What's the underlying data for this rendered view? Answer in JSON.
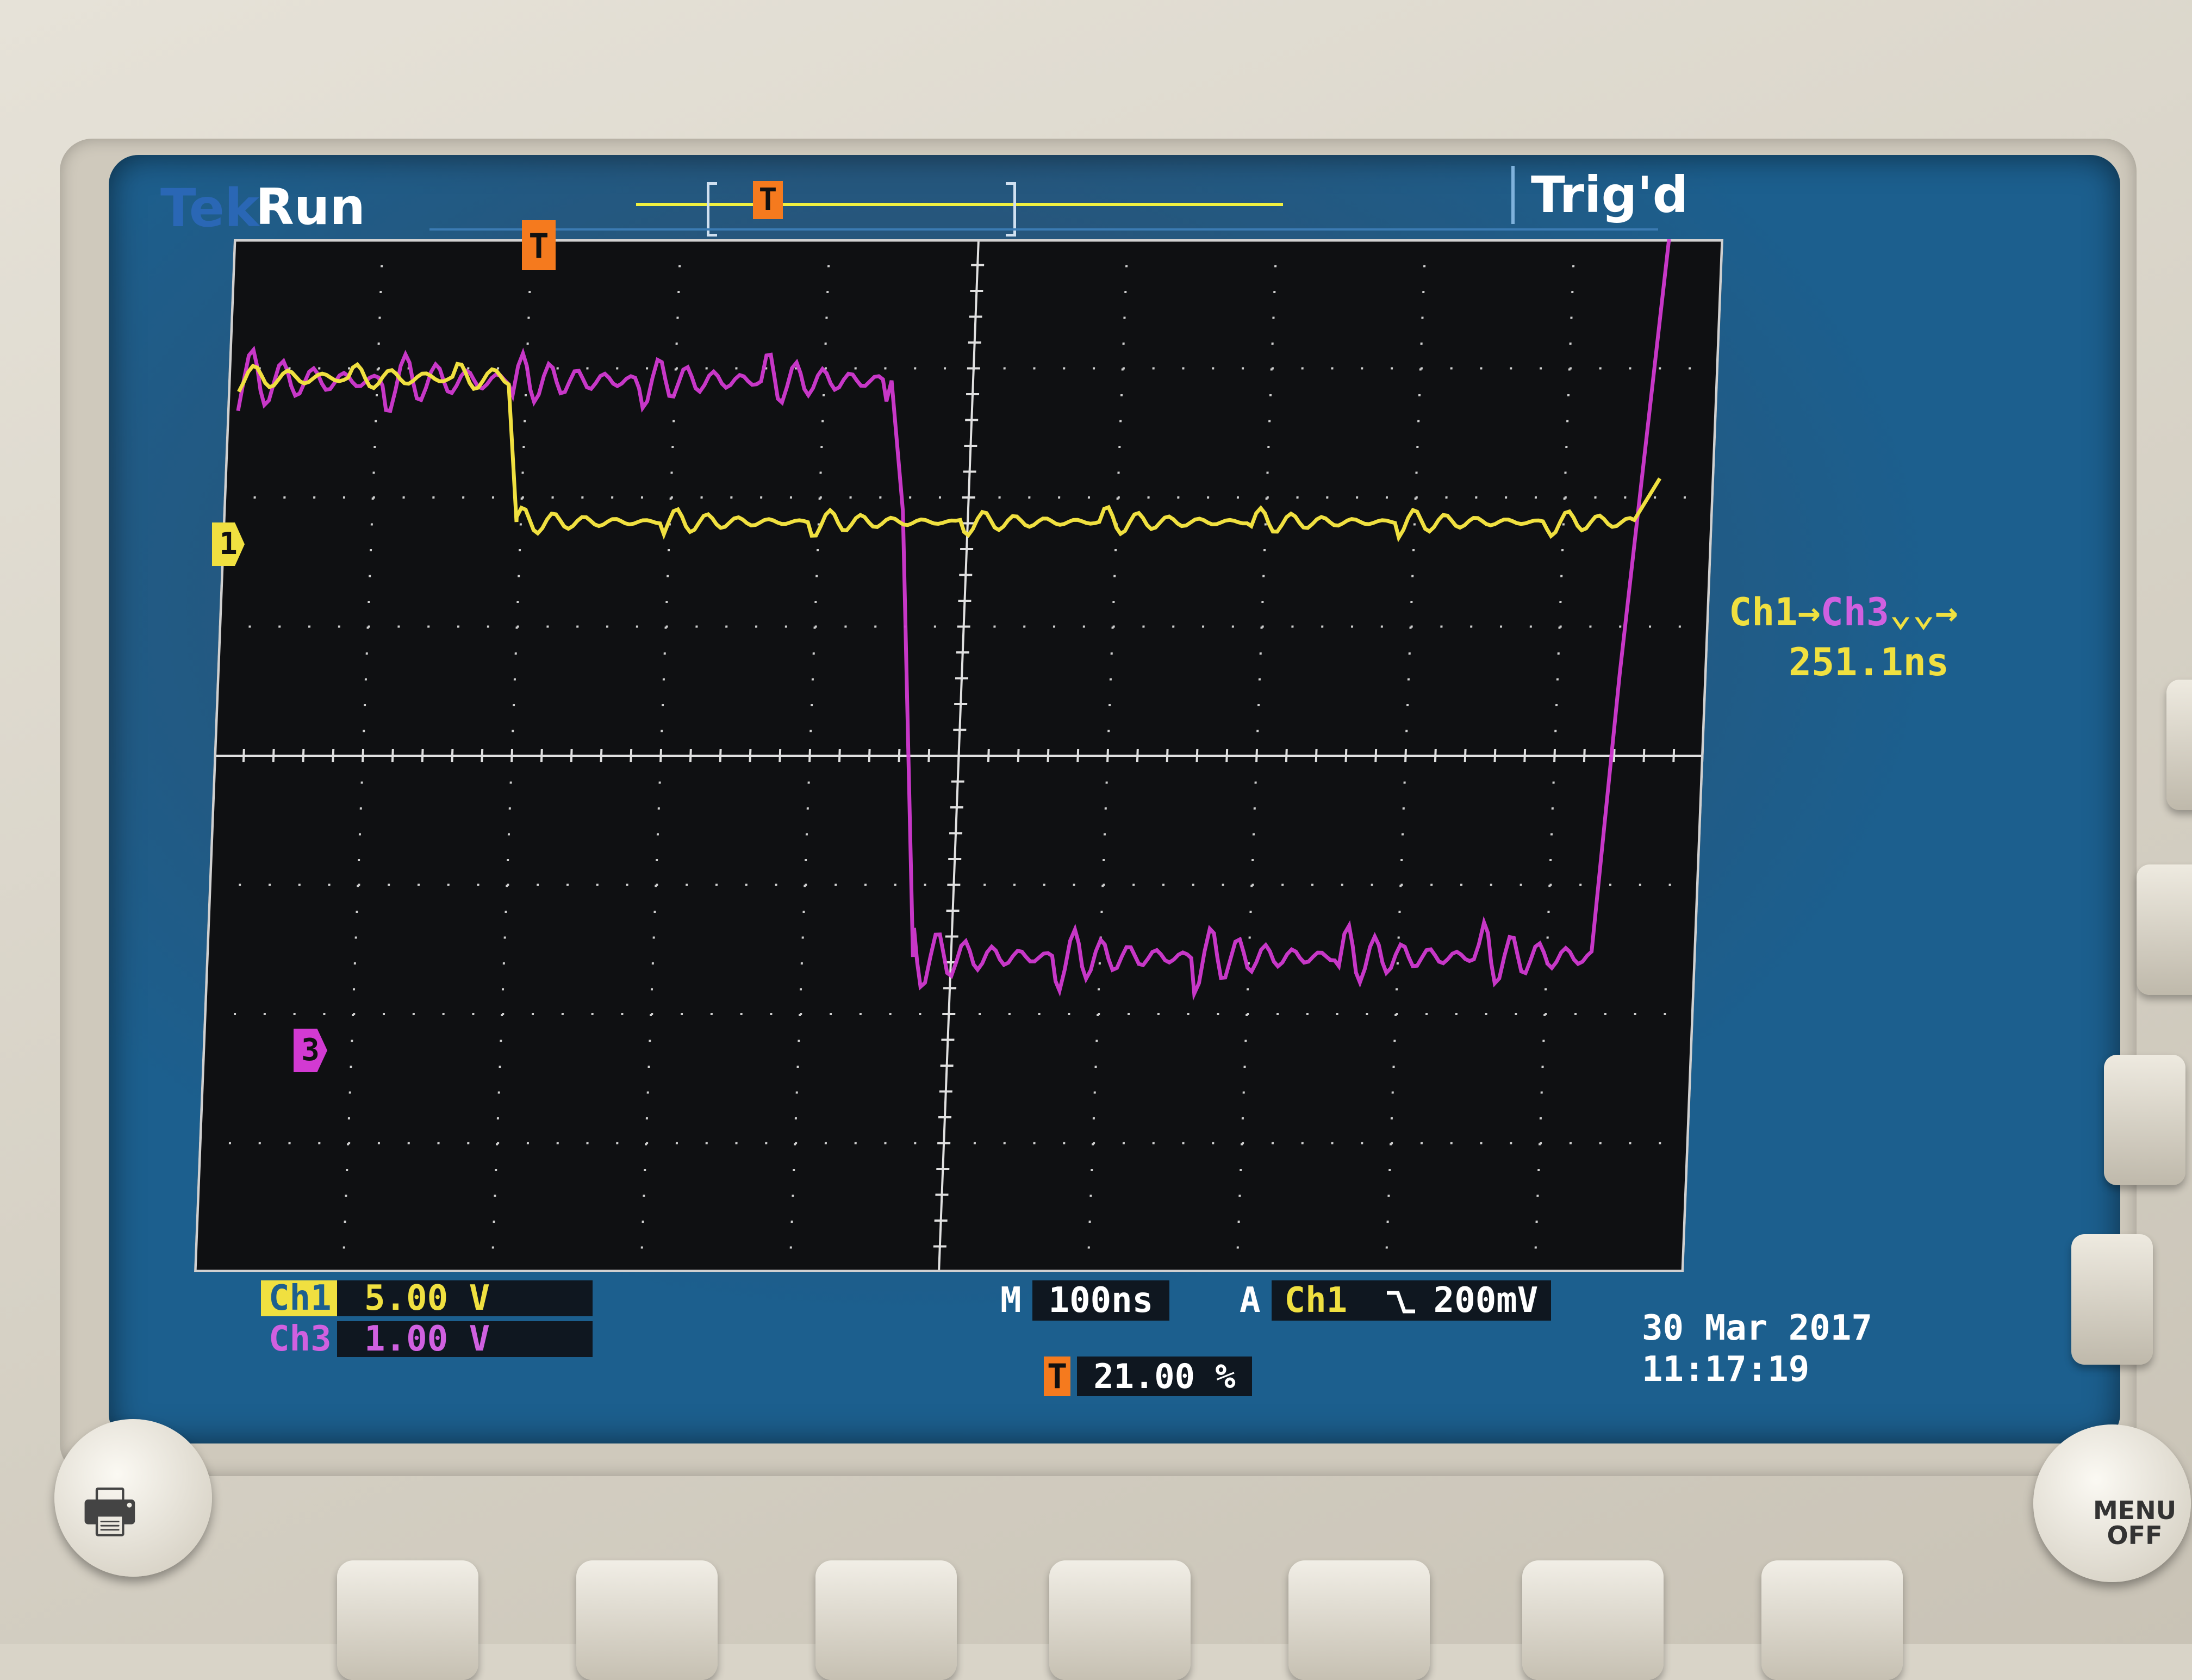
{
  "header": {
    "brand": "Tek",
    "status": "Run",
    "trigger_state": "Trig'd"
  },
  "markers": {
    "trigger": "T",
    "ch1": "1",
    "ch3": "3"
  },
  "measurement": {
    "label_prefix": "Ch1→",
    "label_ch3": "Ch3",
    "label_suffix": "⌄⌄→",
    "value": "251.1ns"
  },
  "channels": {
    "ch1": {
      "label": "Ch1",
      "scale": "5.00 V"
    },
    "ch3": {
      "label": "Ch3",
      "scale": "1.00 V"
    }
  },
  "timebase": {
    "label": "M",
    "value": "100ns"
  },
  "trigger": {
    "label": "A",
    "source": "Ch1",
    "slope_icon": "falling-edge",
    "level": "200mV"
  },
  "trigger_position": {
    "icon": "T",
    "value": "21.00 %"
  },
  "datetime": {
    "date": "30 Mar 2017",
    "time": "11:17:19"
  },
  "buttons": {
    "menu_off": "MENU\nOFF"
  },
  "colors": {
    "ch1": "#f0e040",
    "ch3": "#d23ad2",
    "screen_bg": "#1c5f8e",
    "plot_bg": "#0f1012",
    "trigger_marker": "#f57a1e"
  }
}
